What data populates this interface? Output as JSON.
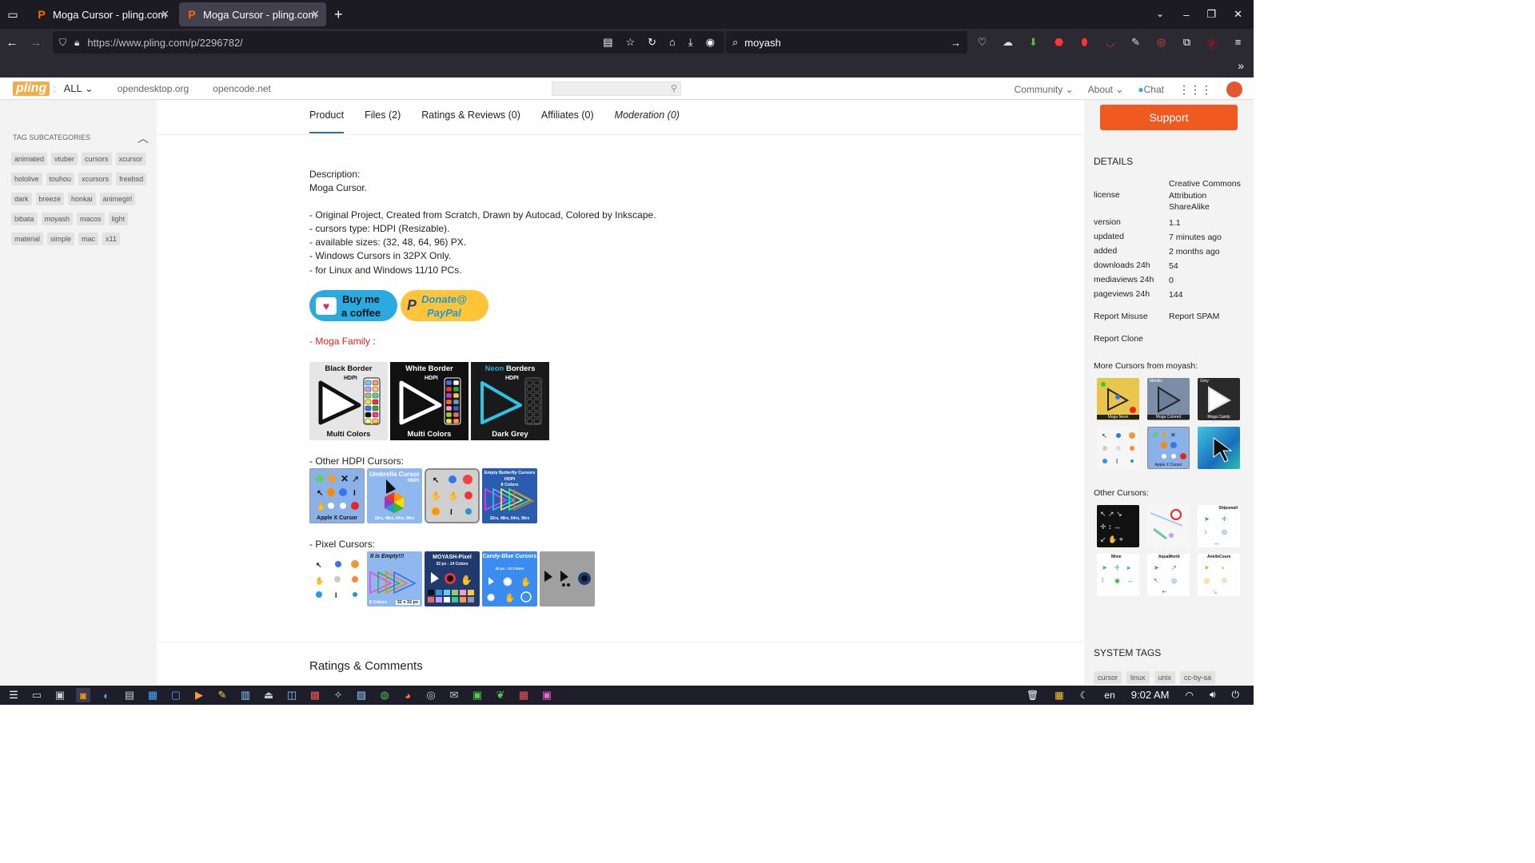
{
  "browser": {
    "tabs": [
      {
        "title": "Moga Cursor - pling.com",
        "active": false
      },
      {
        "title": "Moga Cursor - pling.com",
        "active": true
      }
    ],
    "url": "https://www.pling.com/p/2296782/",
    "search_query": "moyash"
  },
  "site": {
    "logo": "pling",
    "all_label": "ALL",
    "links": [
      "opendesktop.org",
      "opencode.net"
    ],
    "community": "Community",
    "about": "About",
    "chat": "Chat"
  },
  "left_sidebar": {
    "heading": "TAG SUBCATEGORIES",
    "tags": [
      "animated",
      "vtuber",
      "cursors",
      "xcursor",
      "hololive",
      "touhou",
      "xcursors",
      "freebsd",
      "dark",
      "breeze",
      "honkai",
      "animegirl",
      "bibata",
      "moyash",
      "macos",
      "light",
      "material",
      "simple",
      "mac",
      "x11"
    ]
  },
  "product_tabs": [
    "Product",
    "Files (2)",
    "Ratings & Reviews (0)",
    "Affiliates (0)",
    "Moderation (0)"
  ],
  "description": {
    "heading": "Description:",
    "lines": [
      "Moga Cursor.",
      "",
      "- Original Project, Created from Scratch, Drawn by Autocad, Colored by Inkscape.",
      "- cursors type: HDPI (Resizable).",
      "- available sizes: (32, 48, 64, 96) PX.",
      "- Windows Cursors in 32PX Only.",
      "- for Linux and Windows 11/10 PCs."
    ]
  },
  "donate": {
    "coffee_label_1": "Buy me",
    "coffee_label_2": "a coffee",
    "paypal_label_1": "Donate@",
    "paypal_label_2": "PayPal"
  },
  "moga_family": {
    "prefix": "- ",
    "label": "Moga Family",
    "suffix": " :",
    "cards": [
      {
        "top": "Black Border",
        "hdpi": "HDPI",
        "bottom": "Multi Colors"
      },
      {
        "top": "White Border",
        "hdpi": "HDPI",
        "bottom": "Multi Colors"
      },
      {
        "top_accent": "Neon",
        "top": " Borders",
        "hdpi": "HDPI",
        "bottom": "Dark Grey"
      }
    ]
  },
  "other_hdpi": {
    "label": "- Other HDPI Cursors:",
    "thumbs": [
      {
        "caption": "Apple X Cursor"
      },
      {
        "title": "Umbrella Cursor",
        "sub": "HDPI",
        "caption": "32rx, 48rx, 64rx, 96rx"
      },
      {},
      {
        "title": "Empty Butterfly Cursors",
        "sub": "HDPI",
        "sub2": "8 Colors",
        "caption": "32rx, 48rx, 64rx, 96rx"
      }
    ]
  },
  "pixel_cursors": {
    "label": "- Pixel Cursors:",
    "thumbs": [
      {},
      {
        "title": "It is Empty!!!",
        "caption_left": "8 Colors",
        "caption_right": "32 x 32 px"
      },
      {
        "title": "MOYASH-Pixel",
        "sub": "32 px - 14 Colors"
      },
      {
        "title": "Candy-Blue Cursors",
        "sub": "32 px - 12 Colors"
      },
      {}
    ]
  },
  "ratings_title": "Ratings & Comments",
  "right_sidebar": {
    "support": "Support",
    "details_title": "DETAILS",
    "details": [
      {
        "k": "license",
        "v": "Creative Commons Attribution ShareAlike"
      },
      {
        "k": "version",
        "v": "1.1"
      },
      {
        "k": "updated",
        "v": "7 minutes ago"
      },
      {
        "k": "added",
        "v": "2 months ago"
      },
      {
        "k": "downloads 24h",
        "v": "54"
      },
      {
        "k": "mediaviews 24h",
        "v": "0"
      },
      {
        "k": "pageviews 24h",
        "v": "144"
      }
    ],
    "report_misuse": "Report Misuse",
    "report_spam": "Report SPAM",
    "report_clone": "Report Clone",
    "more_title": "More Cursors from moyash:",
    "more_captions": [
      "Moga Neon",
      "Moga Colored",
      "Moga Candy",
      "",
      "Apple X Cursor",
      ""
    ],
    "more_labels": [
      "",
      "Metalic",
      "Grey",
      "",
      "",
      ""
    ],
    "other_title": "Other Cursors:",
    "other_labels": [
      "",
      "",
      "Shipsmall",
      "Mivie",
      "AquaWorld",
      "AnelleCoure"
    ],
    "system_tags_title": "SYSTEM TAGS",
    "system_tags": [
      "cursor",
      "linux",
      "unix",
      "cc-by-sa"
    ]
  },
  "taskbar": {
    "lang": "en",
    "time": "9:02 AM"
  },
  "colors": {
    "accent_orange": "#ee5a1f",
    "active_tab_underline": "#2a6ebb",
    "family_red": "#e02020"
  }
}
